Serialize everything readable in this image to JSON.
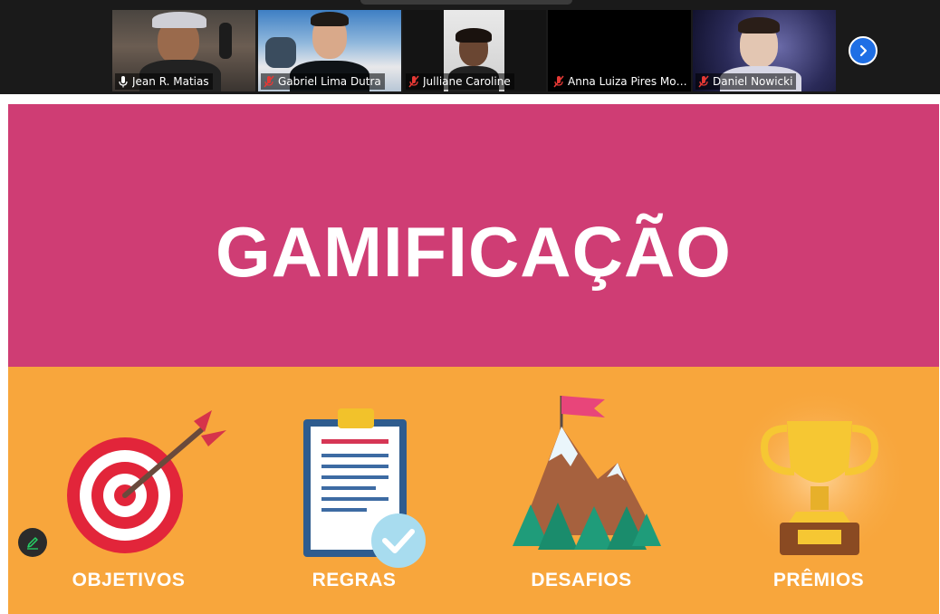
{
  "participants": [
    {
      "name": "Jean R. Matias",
      "muted": false,
      "active": true
    },
    {
      "name": "Gabriel Lima Dutra",
      "muted": true,
      "active": false
    },
    {
      "name": "Julliane Caroline",
      "muted": true,
      "active": false
    },
    {
      "name": "Anna Luiza Pires Mou...",
      "muted": true,
      "active": false
    },
    {
      "name": "Daniel Nowicki",
      "muted": true,
      "active": false
    }
  ],
  "gallery": {
    "next_icon": "chevron-right-icon"
  },
  "slide": {
    "title": "GAMIFICAÇÃO",
    "items": [
      {
        "label": "OBJETIVOS",
        "icon": "target-icon"
      },
      {
        "label": "REGRAS",
        "icon": "clipboard-icon"
      },
      {
        "label": "DESAFIOS",
        "icon": "mountain-flag-icon"
      },
      {
        "label": "PRÊMIOS",
        "icon": "trophy-icon"
      }
    ],
    "colors": {
      "top": "#cf3d74",
      "bottom": "#f8a63c",
      "active_speaker": "#25d366"
    }
  },
  "tools": {
    "annotate_icon": "pencil-icon"
  }
}
